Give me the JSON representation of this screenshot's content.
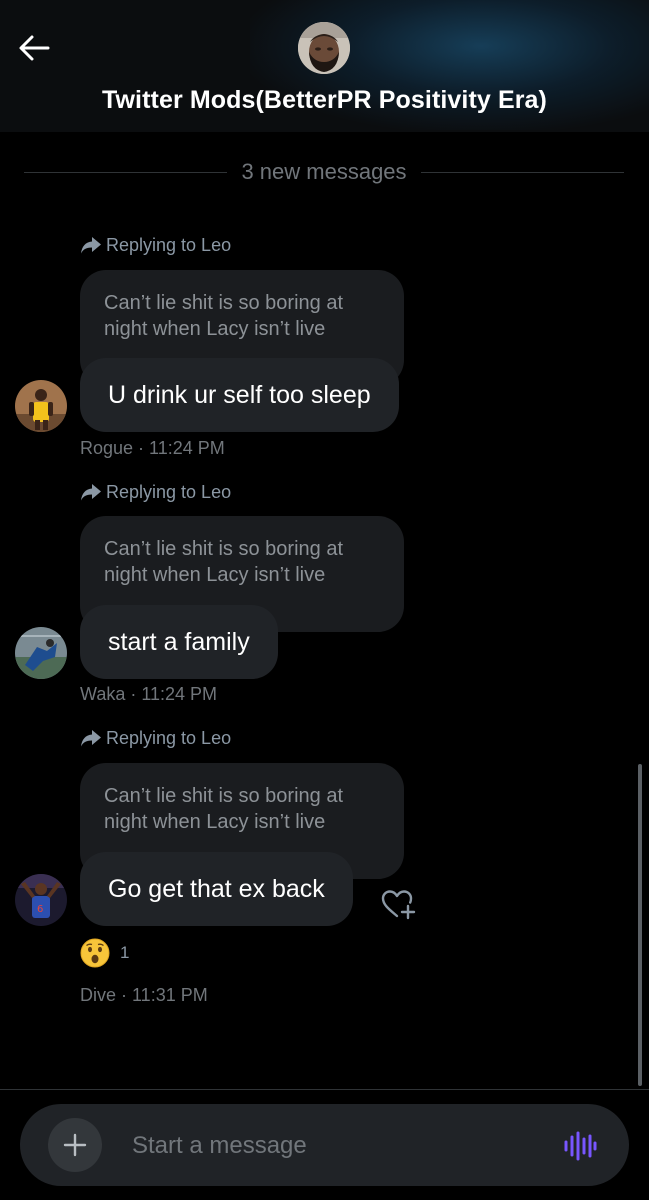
{
  "header": {
    "title": "Twitter Mods(BetterPR Positivity Era)",
    "back_icon": "back-arrow-icon",
    "glow_color": "#184664"
  },
  "divider": {
    "label": "3 new messages"
  },
  "messages": [
    {
      "reply_label": "Replying to Leo",
      "quoted_text": "Can’t lie shit is so boring at night when Lacy isn’t live",
      "text": "U drink ur self too sleep",
      "sender": "Rogue",
      "time": "11:24 PM",
      "meta": "Rogue · 11:24 PM"
    },
    {
      "reply_label": "Replying to Leo",
      "quoted_text": "Can’t lie shit is so boring at night when Lacy isn’t live",
      "text": "start a family",
      "sender": "Waka",
      "time": "11:24 PM",
      "meta": "Waka · 11:24 PM"
    },
    {
      "reply_label": "Replying to Leo",
      "quoted_text": "Can’t lie shit is so boring at night when Lacy isn’t live",
      "text": "Go get that ex back",
      "sender": "Dive",
      "time": "11:31 PM",
      "meta": "Dive · 11:31 PM",
      "reaction": {
        "emoji": "astonished-face-icon",
        "count": "1"
      }
    }
  ],
  "composer": {
    "placeholder": "Start a message",
    "plus_icon": "plus-icon",
    "voice_icon": "voice-waveform-icon",
    "accent_color": "#7856ff"
  }
}
